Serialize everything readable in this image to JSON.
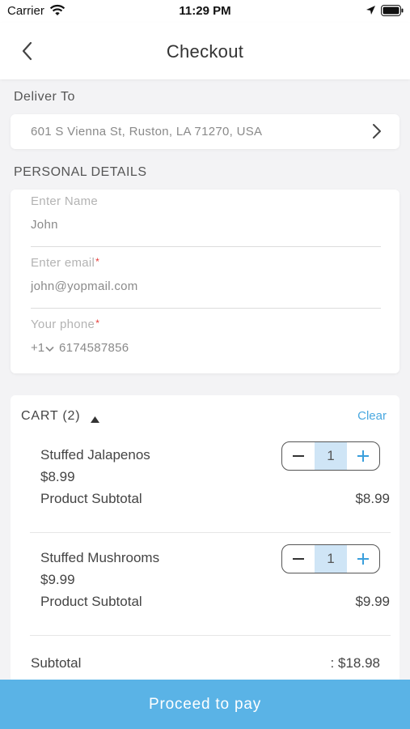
{
  "status_bar": {
    "carrier": "Carrier",
    "time": "11:29 PM"
  },
  "header": {
    "title": "Checkout"
  },
  "delivery": {
    "label": "Deliver To",
    "address": "601 S Vienna St, Ruston, LA 71270, USA"
  },
  "personal": {
    "label": "PERSONAL DETAILS",
    "name_placeholder": "Enter Name",
    "name_value": "John",
    "email_placeholder": "Enter email",
    "email_value": "john@yopmail.com",
    "phone_placeholder": "Your phone",
    "country_code": "+1",
    "phone_value": "6174587856",
    "required_mark": "*"
  },
  "cart": {
    "title": "CART (2)",
    "clear_label": "Clear",
    "items": [
      {
        "name": "Stuffed Jalapenos",
        "price": "$8.99",
        "quantity": "1",
        "subtotal_label": "Product Subtotal",
        "subtotal_value": "$8.99"
      },
      {
        "name": "Stuffed Mushrooms",
        "price": "$9.99",
        "quantity": "1",
        "subtotal_label": "Product Subtotal",
        "subtotal_value": "$9.99"
      }
    ],
    "subtotal_label": "Subtotal",
    "subtotal_value": ":  $18.98"
  },
  "footer": {
    "pay_label": "Proceed to pay"
  },
  "colors": {
    "accent": "#5ab3e6",
    "link": "#4aa8e0",
    "required": "#e53935",
    "qty_bg": "#cfe5f6"
  }
}
